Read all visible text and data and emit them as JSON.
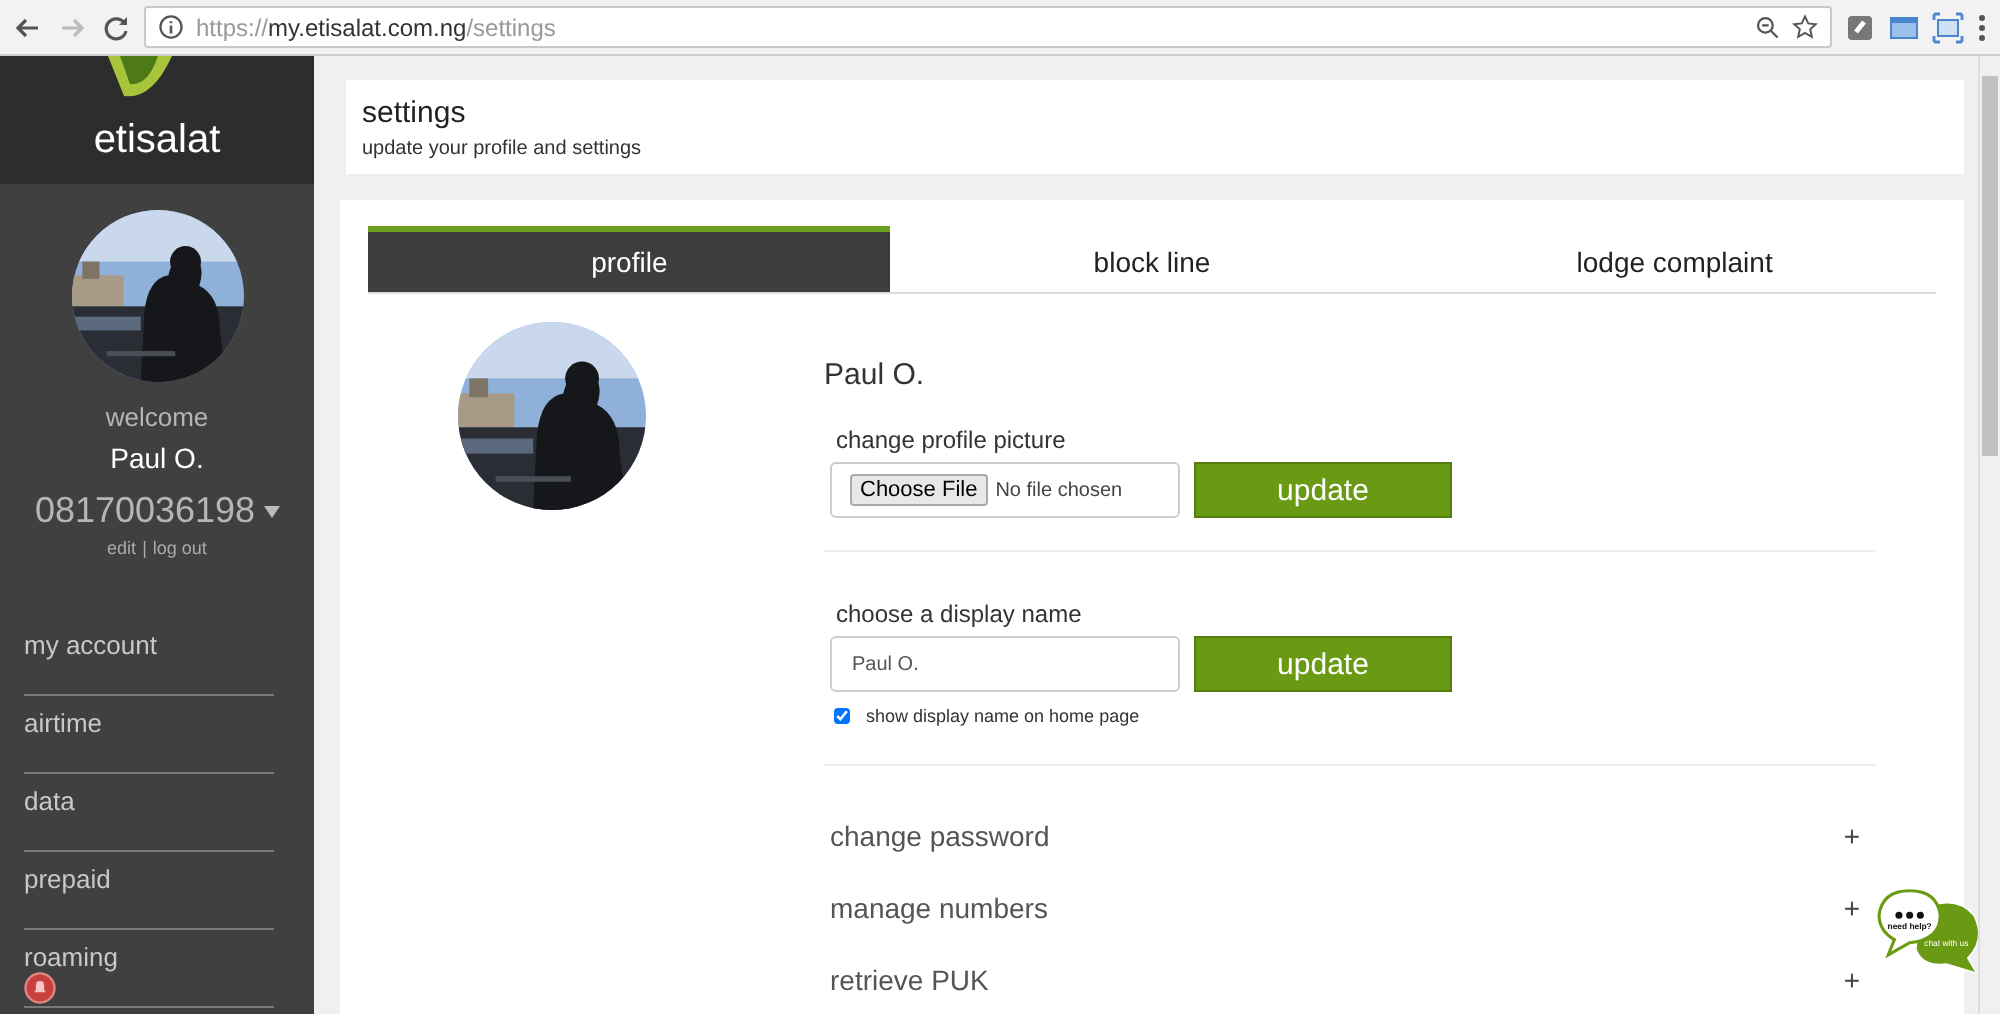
{
  "browser": {
    "url_scheme": "https://",
    "url_host": "my.etisalat.com.ng",
    "url_path": "/settings"
  },
  "sidebar": {
    "logo_text": "etisalat",
    "welcome": "welcome",
    "user_name": "Paul O.",
    "phone": "08170036198",
    "links": [
      "edit",
      "log out"
    ],
    "separator": "|",
    "items": [
      {
        "label": "my account"
      },
      {
        "label": "airtime"
      },
      {
        "label": "data"
      },
      {
        "label": "prepaid"
      },
      {
        "label": "roaming"
      }
    ]
  },
  "header": {
    "title": "settings",
    "subtitle": "update your profile and settings"
  },
  "tabs": [
    {
      "label": "profile",
      "selected": true
    },
    {
      "label": "block line",
      "selected": false
    },
    {
      "label": "lodge complaint",
      "selected": false
    }
  ],
  "profile": {
    "name": "Paul O.",
    "picture": {
      "label": "change profile picture",
      "file_button": "Choose File",
      "file_status": "No file chosen",
      "button": "update"
    },
    "display_name": {
      "label": "choose a display name",
      "value": "Paul O.",
      "button": "update",
      "checkbox": {
        "label": "show display name on home page",
        "checked": true
      }
    }
  },
  "accordion": [
    {
      "label": "change password",
      "toggle": "+"
    },
    {
      "label": "manage numbers",
      "toggle": "+"
    },
    {
      "label": "retrieve PUK",
      "toggle": "+"
    }
  ],
  "chat": {
    "help": "need help?",
    "chat": "chat with us"
  }
}
